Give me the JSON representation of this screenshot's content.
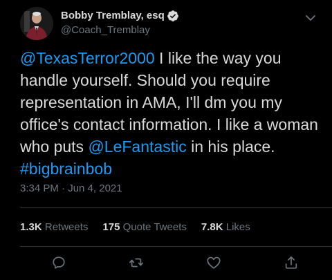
{
  "user": {
    "display_name": "Bobby Tremblay, esq",
    "handle": "@Coach_Tremblay",
    "verified": true
  },
  "tweet": {
    "segments": [
      {
        "text": "@TexasTerror2000",
        "type": "mention"
      },
      {
        "text": " I like the way you handle yourself. Should you require representation in AMA, I'll dm you my office's contact information. I like a woman who puts ",
        "type": "text"
      },
      {
        "text": "@LeFantastic",
        "type": "mention"
      },
      {
        "text": " in his place. ",
        "type": "text"
      },
      {
        "text": "#bigbrainbob",
        "type": "hashtag"
      }
    ],
    "timestamp": "3:34 PM · Jun 4, 2021"
  },
  "stats": {
    "retweets_count": "1.3K",
    "retweets_label": "Retweets",
    "quotes_count": "175",
    "quotes_label": "Quote Tweets",
    "likes_count": "7.8K",
    "likes_label": "Likes"
  },
  "actions": [
    "reply-icon",
    "retweet-icon",
    "like-icon",
    "share-icon"
  ],
  "colors": {
    "background": "#000000",
    "text": "#d9d9d9",
    "muted": "#6e767d",
    "link": "#1d9bf0",
    "divider": "#2f3336"
  }
}
